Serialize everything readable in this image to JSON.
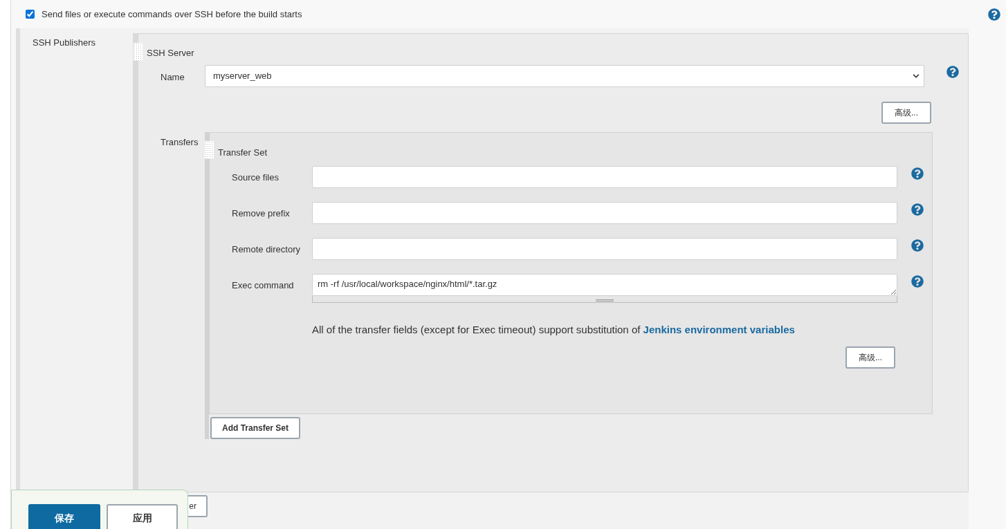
{
  "build_step": {
    "label": "Send files or execute commands over SSH before the build starts",
    "checked": true
  },
  "ssh_publishers": {
    "label": "SSH Publishers",
    "server": {
      "title": "SSH Server",
      "name_label": "Name",
      "name_value": "myserver_web",
      "advanced_button": "高级...",
      "transfers_label": "Transfers",
      "transfer_set": {
        "title": "Transfer Set",
        "fields": [
          {
            "label": "Source files",
            "kind": "input"
          },
          {
            "label": "Remove prefix",
            "kind": "input"
          },
          {
            "label": "Remote directory",
            "kind": "input"
          },
          {
            "label": "Exec command",
            "kind": "textarea",
            "value": "rm -rf /usr/local/workspace/nginx/html/*.tar.gz"
          }
        ],
        "help_text": "All of the transfer fields (except for Exec timeout) support substitution of",
        "help_link": "Jenkins environment variables",
        "advanced_button": "高级..."
      },
      "add_transfer_set_button": "Add Transfer Set"
    },
    "add_server_button": "er"
  },
  "footer": {
    "save_button": "保存",
    "apply_button": "应用"
  }
}
